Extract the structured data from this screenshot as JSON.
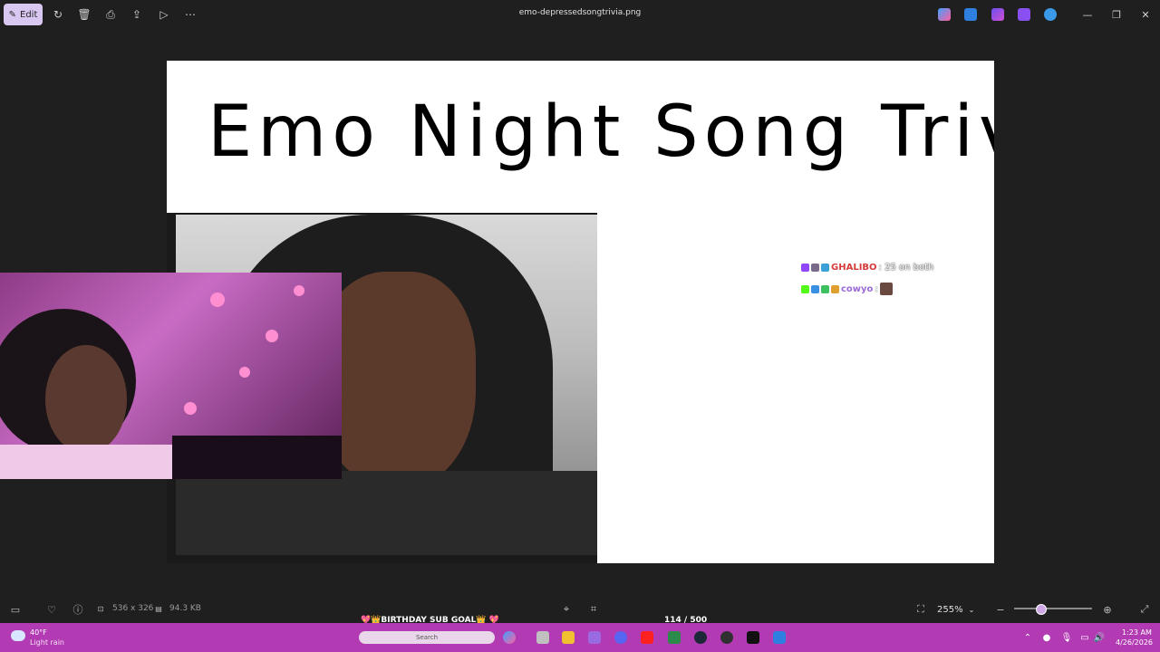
{
  "toolbar": {
    "edit_label": "Edit",
    "file_name": "emo-depressedsongtrivia.png",
    "icons": [
      "rotate-icon",
      "delete-icon",
      "print-icon",
      "share-icon",
      "slideshow-icon",
      "more-icon"
    ],
    "app_icons": [
      "copilot-icon",
      "photo-editor-icon",
      "clipchamp-icon",
      "designer-icon",
      "onedrive-icon"
    ],
    "window_controls": [
      "minimize-icon",
      "restore-icon",
      "close-icon"
    ]
  },
  "image": {
    "title_text": "Emo Night Song Trivia!",
    "chat": [
      {
        "user": "GHALIBO",
        "message": ": 25 on both"
      },
      {
        "user": "cowyo",
        "message": ":"
      }
    ]
  },
  "info_bar": {
    "dimensions": "536 x 326",
    "file_size": "94.3 KB",
    "zoom_label": "255%",
    "zoom_fraction": 0.35
  },
  "stream_overlay": {
    "goal_label": "💖👑BIRTHDAY SUB GOAL👑 💖",
    "goal_count": "114 / 500"
  },
  "taskbar": {
    "temperature": "40°F",
    "weather": "Light rain",
    "search_placeholder": "Search",
    "time": "1:23 AM",
    "date": "4/26/2026"
  },
  "colors": {
    "taskbar": "#b23ab2",
    "edit_accent": "#d8c7f0",
    "chat_user1": "#d63a3a",
    "chat_user2": "#9b6ad8"
  }
}
